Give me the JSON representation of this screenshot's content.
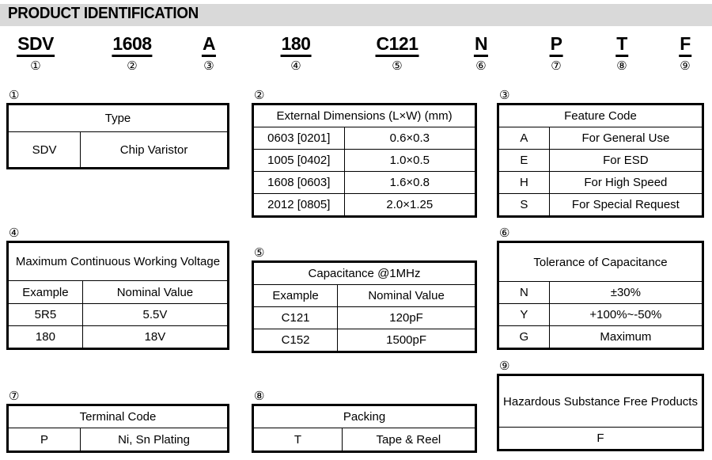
{
  "header": {
    "title": "PRODUCT IDENTIFICATION"
  },
  "part_number": {
    "segments": [
      {
        "code": "SDV",
        "num": "①"
      },
      {
        "code": "1608",
        "num": "②"
      },
      {
        "code": "A",
        "num": "③"
      },
      {
        "code": "180",
        "num": "④"
      },
      {
        "code": "C121",
        "num": "⑤"
      },
      {
        "code": "N",
        "num": "⑥"
      },
      {
        "code": "P",
        "num": "⑦"
      },
      {
        "code": "T",
        "num": "⑧"
      },
      {
        "code": "F",
        "num": "⑨"
      }
    ]
  },
  "tables": {
    "t1": {
      "num": "①",
      "header": "Type",
      "rows": [
        {
          "code": "SDV",
          "value": "Chip Varistor"
        }
      ]
    },
    "t2": {
      "num": "②",
      "header": "External Dimensions (L×W) (mm)",
      "rows": [
        {
          "code": "0603 [0201]",
          "value": "0.6×0.3"
        },
        {
          "code": "1005 [0402]",
          "value": "1.0×0.5"
        },
        {
          "code": "1608 [0603]",
          "value": "1.6×0.8"
        },
        {
          "code": "2012 [0805]",
          "value": "2.0×1.25"
        }
      ]
    },
    "t3": {
      "num": "③",
      "header": "Feature Code",
      "rows": [
        {
          "code": "A",
          "value": "For General Use"
        },
        {
          "code": "E",
          "value": "For ESD"
        },
        {
          "code": "H",
          "value": "For High Speed"
        },
        {
          "code": "S",
          "value": "For Special Request"
        }
      ]
    },
    "t4": {
      "num": "④",
      "header": "Maximum Continuous Working Voltage",
      "subheader": {
        "code": "Example",
        "value": "Nominal Value"
      },
      "rows": [
        {
          "code": "5R5",
          "value": "5.5V"
        },
        {
          "code": "180",
          "value": "18V"
        }
      ]
    },
    "t5": {
      "num": "⑤",
      "header": "Capacitance @1MHz",
      "subheader": {
        "code": "Example",
        "value": "Nominal Value"
      },
      "rows": [
        {
          "code": "C121",
          "value": "120pF"
        },
        {
          "code": "C152",
          "value": "1500pF"
        }
      ]
    },
    "t6": {
      "num": "⑥",
      "header": "Tolerance of Capacitance",
      "rows": [
        {
          "code": "N",
          "value": "±30%"
        },
        {
          "code": "Y",
          "value": "+100%~-50%"
        },
        {
          "code": "G",
          "value": "Maximum"
        }
      ]
    },
    "t7": {
      "num": "⑦",
      "header": "Terminal Code",
      "rows": [
        {
          "code": "P",
          "value": "Ni, Sn Plating"
        }
      ]
    },
    "t8": {
      "num": "⑧",
      "header": "Packing",
      "rows": [
        {
          "code": "T",
          "value": "Tape & Reel"
        }
      ]
    },
    "t9": {
      "num": "⑨",
      "header": "Hazardous Substance Free Products",
      "rows": [
        {
          "value": "F"
        }
      ]
    }
  }
}
